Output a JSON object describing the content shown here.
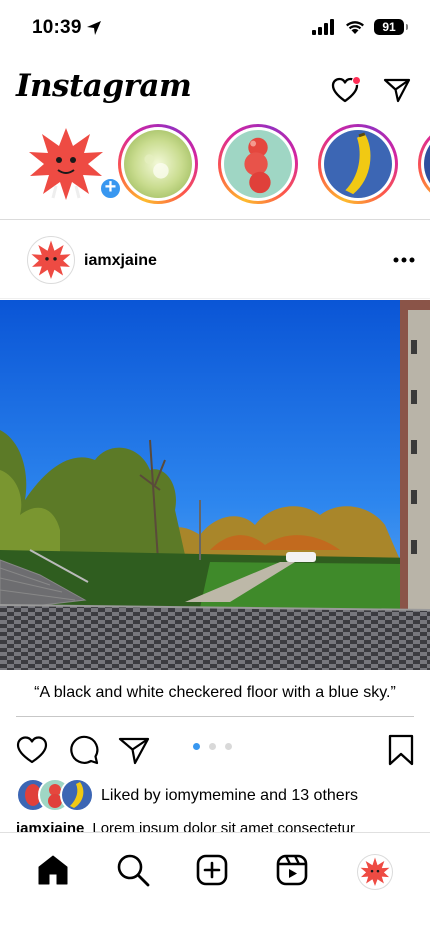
{
  "status_bar": {
    "time": "10:39",
    "battery": "91"
  },
  "app": {
    "logo": "Instagram",
    "accent": "#3897f0",
    "notification_color": "#ff2d55"
  },
  "stories": [
    {
      "type": "own",
      "icon": "starburst-avatar"
    },
    {
      "type": "story",
      "icon": "green-flower-thumbnail"
    },
    {
      "type": "story",
      "icon": "red-fruit-thumbnail"
    },
    {
      "type": "story",
      "icon": "banana-thumbnail"
    }
  ],
  "post": {
    "username": "iamxjaine",
    "image_alt": "“A black and white checkered floor with a blue sky.”",
    "carousel": {
      "count": 3,
      "active": 1
    },
    "liked_by_text": "Liked by iomymemine and 13 others",
    "caption_user": "iamxjaine",
    "caption_text": "Lorem ipsum dolor sit amet consectetur"
  },
  "nav": [
    "home",
    "search",
    "create",
    "reels",
    "profile"
  ]
}
